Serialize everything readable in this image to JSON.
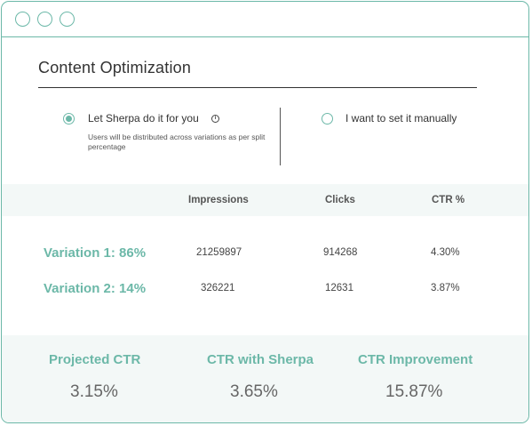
{
  "window": {
    "controls": [
      "window-dot-1",
      "window-dot-2",
      "window-dot-3"
    ]
  },
  "title": "Content Optimization",
  "options": {
    "auto": {
      "label": "Let Sherpa do it for you",
      "info_icon": "i",
      "description": "Users will be distributed across variations as per split percentage",
      "selected": true
    },
    "manual": {
      "label": "I want to set it manually",
      "selected": false
    }
  },
  "table": {
    "headers": [
      "Impressions",
      "Clicks",
      "CTR %"
    ],
    "rows": [
      {
        "label": "Variation 1: 86%",
        "impressions": "21259897",
        "clicks": "914268",
        "ctr": "4.30%"
      },
      {
        "label": "Variation 2: 14%",
        "impressions": "326221",
        "clicks": "12631",
        "ctr": "3.87%"
      }
    ]
  },
  "summary": [
    {
      "label": "Projected CTR",
      "value": "3.15%"
    },
    {
      "label": "CTR with Sherpa",
      "value": "3.65%"
    },
    {
      "label": "CTR Improvement",
      "value": "15.87%"
    }
  ],
  "colors": {
    "accent": "#6cb8a8",
    "band": "#f3f8f7"
  }
}
